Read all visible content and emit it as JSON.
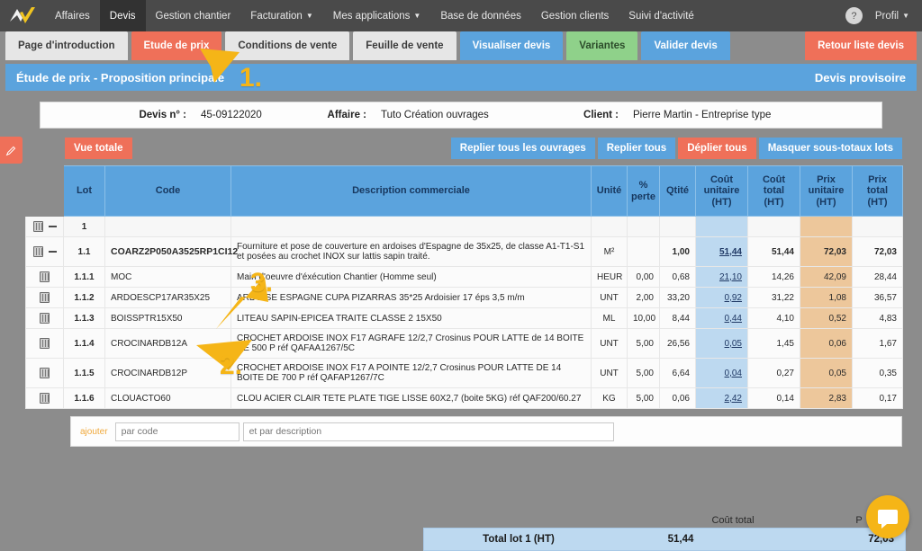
{
  "topnav": {
    "logo": "company-logo",
    "items": [
      {
        "label": "Affaires",
        "active": false,
        "caret": false
      },
      {
        "label": "Devis",
        "active": true,
        "caret": false
      },
      {
        "label": "Gestion chantier",
        "active": false,
        "caret": false
      },
      {
        "label": "Facturation",
        "active": false,
        "caret": true
      },
      {
        "label": "Mes applications",
        "active": false,
        "caret": true
      },
      {
        "label": "Base de données",
        "active": false,
        "caret": false
      },
      {
        "label": "Gestion clients",
        "active": false,
        "caret": false
      },
      {
        "label": "Suivi d'activité",
        "active": false,
        "caret": false
      }
    ],
    "help_label": "?",
    "profil_label": "Profil"
  },
  "tabs": [
    {
      "label": "Page d'introduction",
      "style": "grey"
    },
    {
      "label": "Etude de prix",
      "style": "red"
    },
    {
      "label": "Conditions de vente",
      "style": "grey"
    },
    {
      "label": "Feuille de vente",
      "style": "grey"
    },
    {
      "label": "Visualiser devis",
      "style": "blue"
    },
    {
      "label": "Variantes",
      "style": "green"
    },
    {
      "label": "Valider devis",
      "style": "blue"
    }
  ],
  "tab_right": {
    "label": "Retour liste devis"
  },
  "banner": {
    "title": "Étude de prix - Proposition principale",
    "right": "Devis provisoire"
  },
  "infobar": {
    "devis_label": "Devis n° :",
    "devis_value": "45-09122020",
    "affaire_label": "Affaire :",
    "affaire_value": "Tuto Création ouvrages",
    "client_label": "Client :",
    "client_value": "Pierre Martin - Entreprise type"
  },
  "toolbar": {
    "vue_totale": "Vue totale",
    "replier_ouvrages": "Replier tous les ouvrages",
    "replier_tous": "Replier tous",
    "deplier_tous": "Déplier tous",
    "masquer_sous_totaux": "Masquer sous-totaux lots"
  },
  "edit_tab": {
    "icon": "pencil-icon"
  },
  "table": {
    "headers": [
      "",
      "Lot",
      "Code",
      "Description commerciale",
      "Unité",
      "% perte",
      "Qtité",
      "Coût unitaire (HT)",
      "Coût total (HT)",
      "Prix unitaire (HT)",
      "Prix total (HT)"
    ],
    "headers_multiline": {
      "unite": "Unité",
      "perte_1": "%",
      "perte_2": "perte",
      "qtite": "Qtité",
      "cu_1": "Coût",
      "cu_2": "unitaire",
      "cu_3": "(HT)",
      "ct_1": "Coût",
      "ct_2": "total",
      "ct_3": "(HT)",
      "pu_1": "Prix",
      "pu_2": "unitaire",
      "pu_3": "(HT)",
      "pt_1": "Prix",
      "pt_2": "total",
      "pt_3": "(HT)"
    },
    "rows": [
      {
        "kind": "lot",
        "collapse": true,
        "trash": true,
        "lot": "1",
        "code": "",
        "desc": "",
        "unite": "",
        "perte": "",
        "qtite": "",
        "cu": "",
        "ct": "",
        "pu": "",
        "pt": ""
      },
      {
        "kind": "ouvrage",
        "collapse": true,
        "trash": true,
        "lot": "1.1",
        "code": "COARZ2P050A3525RP1CI12",
        "desc": "Fourniture et pose de couverture en ardoises d'Espagne de 35x25, de classe A1-T1-S1 et posées au crochet INOX sur lattis sapin traité.",
        "unite": "M²",
        "perte": "",
        "qtite": "1,00",
        "cu": "51,44",
        "ct": "51,44",
        "pu": "72,03",
        "pt": "72,03"
      },
      {
        "kind": "ligne",
        "collapse": false,
        "trash": true,
        "lot": "1.1.1",
        "code": "MOC",
        "desc": "Main d'oeuvre d'éxécution Chantier (Homme seul)",
        "unite": "HEUR",
        "perte": "0,00",
        "qtite": "0,68",
        "cu": "21,10",
        "ct": "14,26",
        "pu": "42,09",
        "pt": "28,44"
      },
      {
        "kind": "ligne",
        "collapse": false,
        "trash": true,
        "lot": "1.1.2",
        "code": "ARDOESCP17AR35X25",
        "desc": "ARDOISE ESPAGNE CUPA PIZARRAS 35*25 Ardoisier 17 éps 3,5 m/m",
        "unite": "UNT",
        "perte": "2,00",
        "qtite": "33,20",
        "cu": "0,92",
        "ct": "31,22",
        "pu": "1,08",
        "pt": "36,57"
      },
      {
        "kind": "ligne",
        "collapse": false,
        "trash": true,
        "lot": "1.1.3",
        "code": "BOISSPTR15X50",
        "desc": "LITEAU SAPIN-EPICEA TRAITE CLASSE 2 15X50",
        "unite": "ML",
        "perte": "10,00",
        "qtite": "8,44",
        "cu": "0,44",
        "ct": "4,10",
        "pu": "0,52",
        "pt": "4,83"
      },
      {
        "kind": "ligne",
        "collapse": false,
        "trash": true,
        "lot": "1.1.4",
        "code": "CROCINARDB12A",
        "desc": "CROCHET ARDOISE INOX F17 AGRAFE 12/2,7 Crosinus POUR LATTE de 14 BOITE DE 500 P réf QAFAA1267/5C",
        "unite": "UNT",
        "perte": "5,00",
        "qtite": "26,56",
        "cu": "0,05",
        "ct": "1,45",
        "pu": "0,06",
        "pt": "1,67"
      },
      {
        "kind": "ligne",
        "collapse": false,
        "trash": true,
        "lot": "1.1.5",
        "code": "CROCINARDB12P",
        "desc": "CROCHET ARDOISE INOX F17 A POINTE 12/2,7 Crosinus POUR LATTE DE 14 BOITE DE 700 P réf QAFAP1267/7C",
        "unite": "UNT",
        "perte": "5,00",
        "qtite": "6,64",
        "cu": "0,04",
        "ct": "0,27",
        "pu": "0,05",
        "pt": "0,35"
      },
      {
        "kind": "ligne",
        "collapse": false,
        "trash": true,
        "lot": "1.1.6",
        "code": "CLOUACTO60",
        "desc": "CLOU ACIER CLAIR TETE PLATE TIGE LISSE 60X2,7 (boite 5KG) réf QAF200/60.27",
        "unite": "KG",
        "perte": "5,00",
        "qtite": "0,06",
        "cu": "2,42",
        "ct": "0,14",
        "pu": "2,83",
        "pt": "0,17"
      }
    ]
  },
  "addrow": {
    "label": "ajouter",
    "code_placeholder": "par code",
    "desc_placeholder": "et par description"
  },
  "totals": {
    "cout_total_header": "Coût total",
    "prix_total_header": "P",
    "row_label": "Total lot 1 (HT)",
    "cout_value": "51,44",
    "prix_value": "72,03"
  },
  "chat": {
    "icon": "chat-bubble-icon"
  },
  "annotations": [
    {
      "label": "1.",
      "name": "annotation-step-1"
    },
    {
      "label": "2.",
      "name": "annotation-step-2"
    },
    {
      "label": "3.",
      "name": "annotation-step-3"
    }
  ],
  "colors": {
    "accent_blue": "#5ba3dd",
    "accent_orange": "#ef7059",
    "accent_green": "#8fd18a",
    "cost_col": "#bdd9f0",
    "price_col": "#edc79b",
    "annotation_yellow": "#f5b517",
    "nav_bg": "#4a4a4a",
    "page_bg": "#8c8c8c"
  }
}
